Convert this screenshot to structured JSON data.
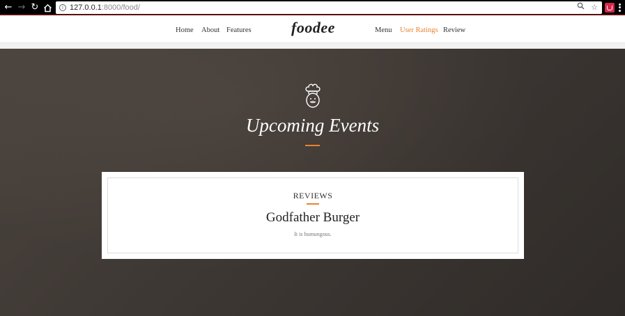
{
  "browser": {
    "url_host": "127.0.0.1",
    "url_rest": ":8000/food/"
  },
  "navbar": {
    "brand": "foodee",
    "left_links": [
      "Home",
      "About",
      "Features"
    ],
    "right_links": [
      "Menu",
      "User Ratings",
      "Review"
    ],
    "active_link": "User Ratings",
    "accent_color": "#e98330"
  },
  "hero": {
    "icon": "chef-icon",
    "title": "Upcoming Events"
  },
  "review_card": {
    "label": "REVIEWS",
    "title": "Godfather Burger",
    "description": "It is humungous."
  }
}
